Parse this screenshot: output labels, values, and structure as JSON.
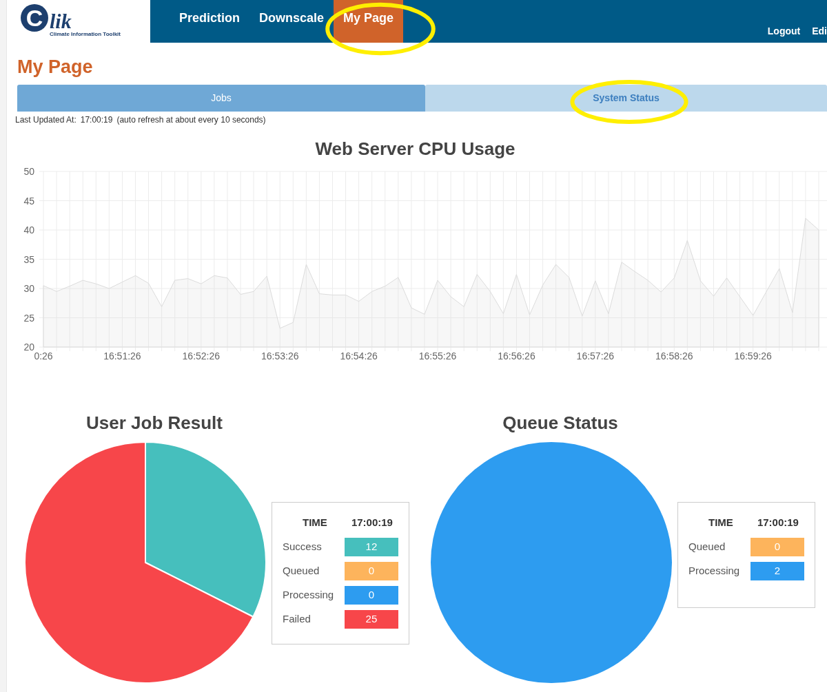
{
  "header": {
    "logo": {
      "initial": "C",
      "rest": "lik",
      "tagline": "Climate Information Toolkit"
    },
    "nav": [
      {
        "label": "Prediction",
        "selected": false,
        "circled": false
      },
      {
        "label": "Downscale",
        "selected": false,
        "circled": false
      },
      {
        "label": "My Page",
        "selected": true,
        "circled": true
      }
    ],
    "user_links": [
      "Logout",
      "Edi"
    ]
  },
  "page_title": "My Page",
  "tabs": [
    {
      "label": "Jobs",
      "selected": false,
      "circled": false
    },
    {
      "label": "System Status",
      "selected": true,
      "circled": true
    }
  ],
  "last_updated": {
    "label": "Last Updated At:",
    "time": "17:00:19",
    "note": "(auto refresh at about every 10 seconds)"
  },
  "cpu_chart": {
    "chart_data": {
      "type": "area",
      "title": "Web Server CPU Usage",
      "grid": true,
      "ylim": [
        20,
        50
      ],
      "yticks": [
        20,
        25,
        30,
        35,
        40,
        45,
        50
      ],
      "categories": [
        "0:26",
        null,
        null,
        null,
        null,
        null,
        "16:51:26",
        null,
        null,
        null,
        null,
        null,
        "16:52:26",
        null,
        null,
        null,
        null,
        null,
        "16:53:26",
        null,
        null,
        null,
        null,
        null,
        "16:54:26",
        null,
        null,
        null,
        null,
        null,
        "16:55:26",
        null,
        null,
        null,
        null,
        null,
        "16:56:26",
        null,
        null,
        null,
        null,
        null,
        "16:57:26",
        null,
        null,
        null,
        null,
        null,
        "16:58:26",
        null,
        null,
        null,
        null,
        null,
        "16:59:26",
        null,
        null,
        null,
        null,
        null
      ],
      "series": [
        {
          "color": "#dcdcdc",
          "values": [
            30.5,
            29.5,
            30.4,
            31.4,
            30.8,
            30.0,
            31.1,
            32.2,
            30.9,
            26.9,
            31.4,
            31.7,
            30.8,
            32.2,
            31.8,
            29.0,
            29.5,
            32.1,
            23.2,
            24.2,
            34.1,
            29.1,
            28.9,
            28.9,
            27.8,
            29.5,
            30.4,
            31.9,
            26.7,
            25.6,
            31.4,
            28.6,
            26.9,
            32.4,
            29.5,
            25.7,
            32.4,
            25.5,
            30.6,
            34.1,
            31.9,
            25.3,
            31.3,
            25.7,
            34.5,
            32.9,
            31.4,
            29.4,
            31.8,
            38.2,
            31.3,
            28.7,
            31.8,
            28.6,
            25.4,
            29.4,
            33.4,
            25.9,
            42.0,
            40.0
          ]
        }
      ]
    }
  },
  "job_result": {
    "chart_data": {
      "type": "pie",
      "title": "User Job Result",
      "categories": [
        "Success",
        "Queued",
        "Processing",
        "Failed"
      ],
      "series": [
        {
          "values": [
            32.43,
            0,
            0,
            67.57
          ]
        }
      ]
    },
    "legend": {
      "time_label": "TIME",
      "time": "17:00:19",
      "rows": [
        {
          "value": "12",
          "color": "#46bfbd"
        },
        {
          "value": "0",
          "color": "#fdb45c"
        },
        {
          "value": "0",
          "color": "#2d9cf0"
        },
        {
          "value": "25",
          "color": "#f7464a"
        }
      ]
    }
  },
  "queue_status": {
    "chart_data": {
      "type": "pie",
      "title": "Queue Status",
      "categories": [
        "Queued",
        "Processing"
      ],
      "series": [
        {
          "values": [
            0,
            100
          ]
        }
      ]
    },
    "legend": {
      "time_label": "TIME",
      "time": "17:00:19",
      "rows": [
        {
          "value": "0",
          "color": "#fdb45c"
        },
        {
          "value": "2",
          "color": "#2d9cf0"
        }
      ]
    }
  }
}
